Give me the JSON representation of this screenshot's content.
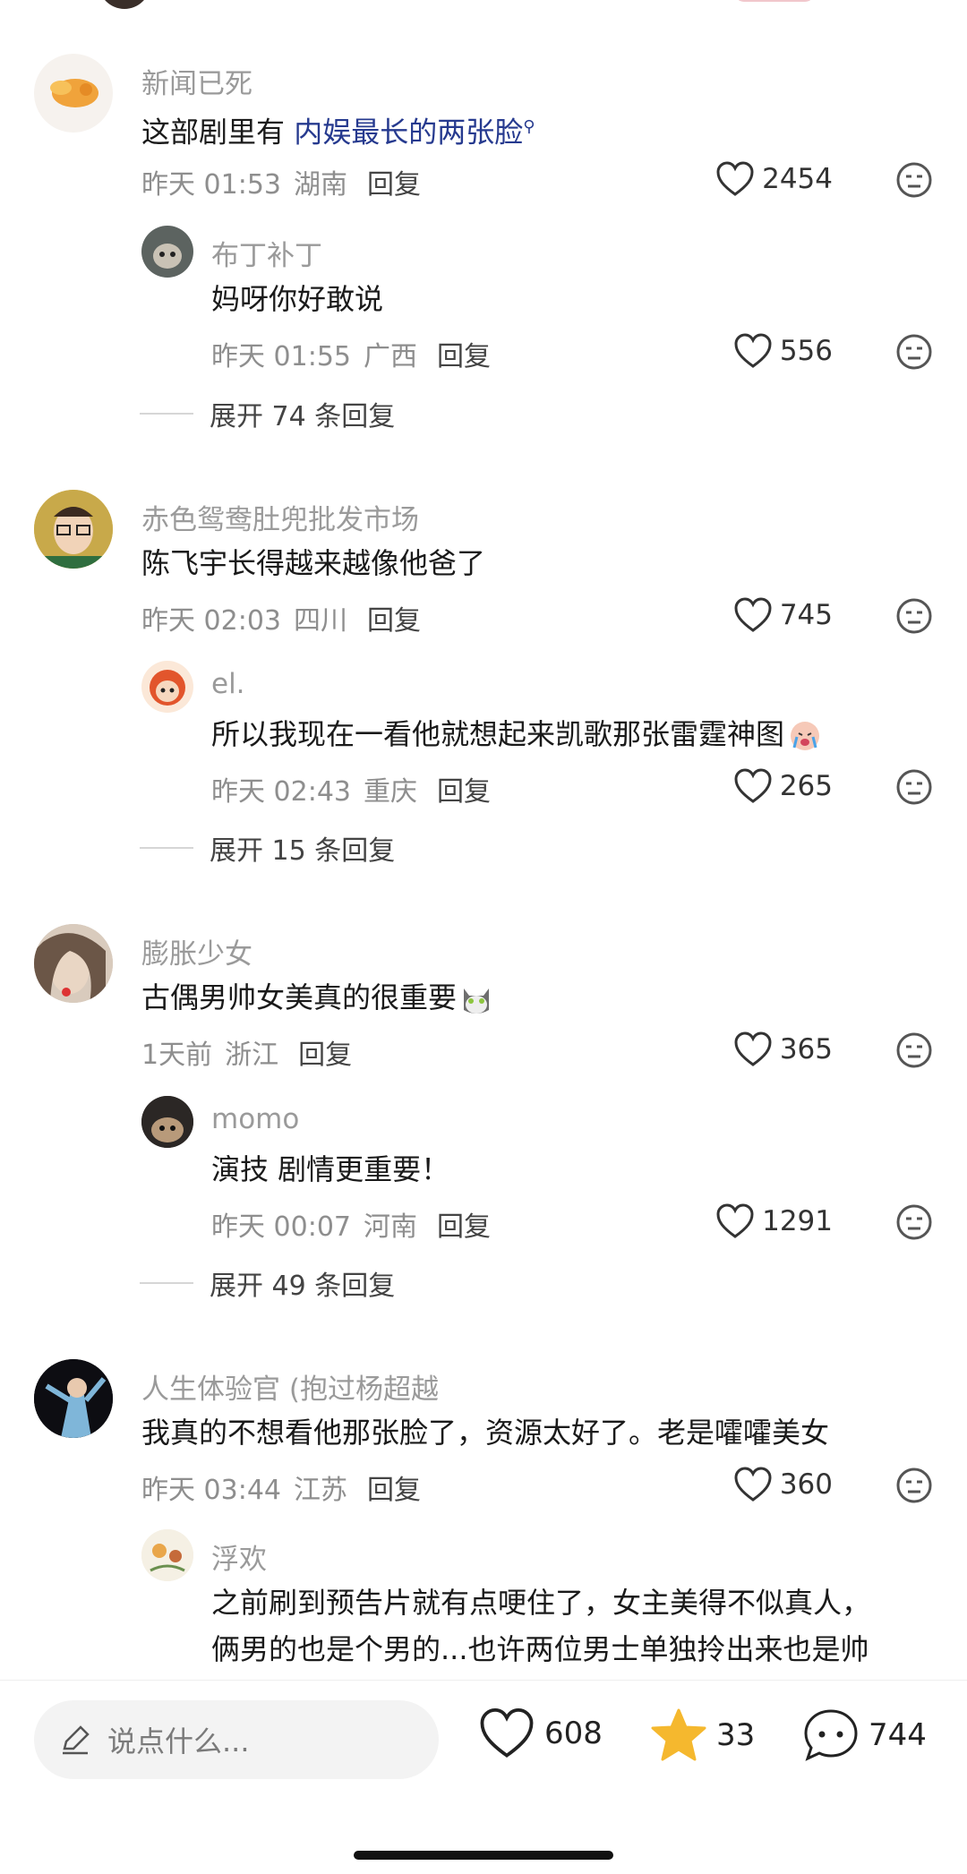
{
  "comments": [
    {
      "username": "新闻已死",
      "text": "这部剧里有 ",
      "highlight": "内娱最长的两张脸",
      "time": "昨天 01:53",
      "location": "湖南",
      "reply_label": "回复",
      "likes": "2454",
      "reply": {
        "username": "布丁补丁",
        "text": "妈呀你好敢说",
        "time": "昨天 01:55",
        "location": "广西",
        "reply_label": "回复",
        "likes": "556"
      },
      "expand": "展开 74 条回复"
    },
    {
      "username": "赤色鸳鸯肚兜批发市场",
      "text": "陈飞宇长得越来越像他爸了",
      "time": "昨天 02:03",
      "location": "四川",
      "reply_label": "回复",
      "likes": "745",
      "reply": {
        "username": "el.",
        "text": "所以我现在一看他就想起来凯歌那张雷霆神图",
        "time": "昨天 02:43",
        "location": "重庆",
        "reply_label": "回复",
        "likes": "265"
      },
      "expand": "展开 15 条回复"
    },
    {
      "username": "膨胀少女",
      "text": "古偶男帅女美真的很重要",
      "time": "1天前",
      "location": "浙江",
      "reply_label": "回复",
      "likes": "365",
      "reply": {
        "username": "momo",
        "text": "演技  剧情更重要！",
        "time": "昨天 00:07",
        "location": "河南",
        "reply_label": "回复",
        "likes": "1291"
      },
      "expand": "展开 49 条回复"
    },
    {
      "username": "人生体验官 (抱过杨超越",
      "text": "我真的不想看他那张脸了，资源太好了。老是嚯嚯美女",
      "time": "昨天 03:44",
      "location": "江苏",
      "reply_label": "回复",
      "likes": "360",
      "reply": {
        "username": "浮欢",
        "text": "之前刷到预告片就有点哽住了，女主美得不似真人，",
        "text2": "俩男的也是个男的...也许两位男士单独拎出来也是帅"
      }
    }
  ],
  "bottom_bar": {
    "input_placeholder": "说点什么...",
    "likes": "608",
    "stars": "33",
    "comments": "744"
  },
  "colors": {
    "accent_link": "#263a8f",
    "star": "#f5b82e"
  }
}
